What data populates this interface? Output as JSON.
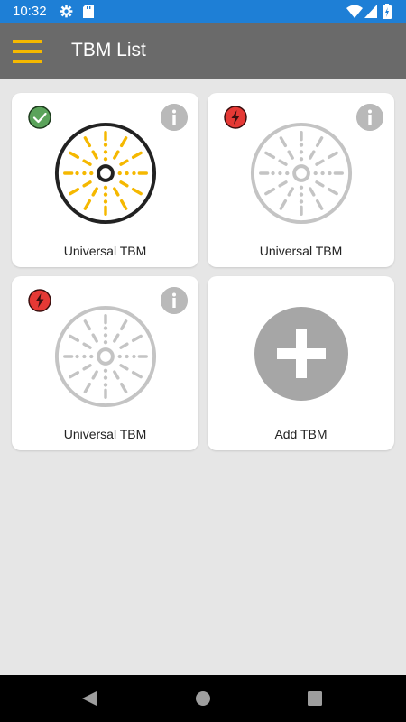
{
  "status_bar": {
    "time": "10:32",
    "icons": [
      "settings-icon",
      "sd-card-icon",
      "wifi-icon",
      "signal-icon",
      "battery-icon"
    ]
  },
  "app_bar": {
    "title": "TBM List",
    "menu_icon": "hamburger-icon",
    "accent_color": "#f5b800"
  },
  "cards": [
    {
      "label": "Universal TBM",
      "status": "connected",
      "status_icon": "check-icon",
      "active": true
    },
    {
      "label": "Universal TBM",
      "status": "disconnected",
      "status_icon": "lightning-icon",
      "active": false
    },
    {
      "label": "Universal TBM",
      "status": "disconnected",
      "status_icon": "lightning-icon",
      "active": false
    }
  ],
  "add_card": {
    "label": "Add TBM",
    "icon": "plus-icon"
  },
  "colors": {
    "status_bar": "#1e7fd6",
    "app_bar": "#6a6a6a",
    "active_cutter": "#f5b800",
    "active_ring": "#222222",
    "inactive": "#c4c4c4",
    "connected_badge": "#5aa35a",
    "disconnected_badge": "#e53935",
    "info_button": "#b9b9b9"
  },
  "nav_bar": {
    "buttons": [
      "back-icon",
      "home-icon",
      "recents-icon"
    ]
  }
}
